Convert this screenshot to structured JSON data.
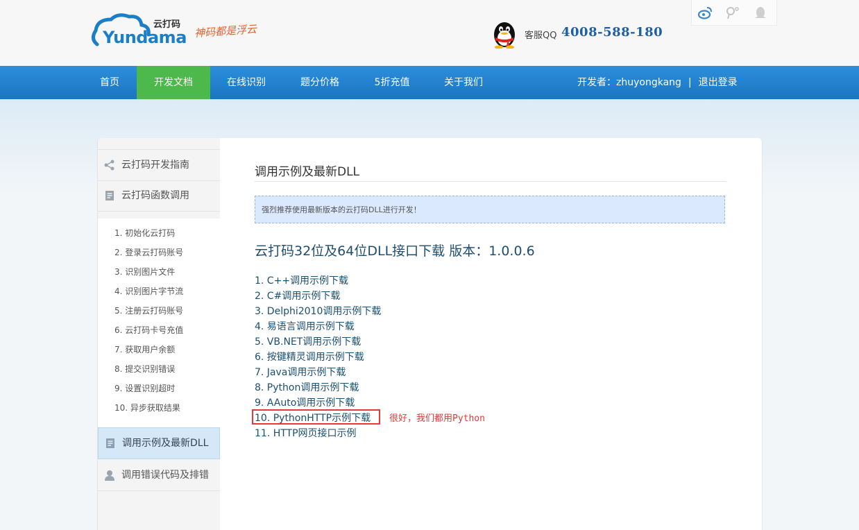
{
  "header": {
    "logo_cn": "云打码",
    "logo_en": "Yundama",
    "slogan": "神码都是浮云",
    "service_label": "客服QQ",
    "service_phone": "4008-588-180",
    "social_icons": [
      "weibo-icon",
      "tencent-weibo-icon",
      "qq-icon"
    ]
  },
  "nav": {
    "items": [
      {
        "label": "首页"
      },
      {
        "label": "开发文档",
        "active": true
      },
      {
        "label": "在线识别"
      },
      {
        "label": "题分价格"
      },
      {
        "label": "5折充值"
      },
      {
        "label": "关于我们"
      }
    ],
    "developer_label": "开发者：zhuyongkang",
    "separator": "|",
    "logout": "退出登录",
    "active_color": "#4db94c",
    "bar_color": "#1f7fce"
  },
  "sidebar": {
    "sections": [
      {
        "label": "云打码开发指南",
        "icon": "share-icon"
      },
      {
        "label": "云打码函数调用",
        "icon": "document-icon"
      }
    ],
    "sub_items": [
      "1. 初始化云打码",
      "2. 登录云打码账号",
      "3. 识别图片文件",
      "4. 识别图片字节流",
      "5. 注册云打码账号",
      "6. 云打码卡号充值",
      "7. 获取用户余额",
      "8. 提交识别错误",
      "9. 设置识别超时",
      "10. 异步获取结果"
    ],
    "active_section": {
      "label": "调用示例及最新DLL",
      "icon": "document-icon"
    },
    "last_section": {
      "label": "调用错误代码及排错",
      "icon": "user-icon"
    }
  },
  "content": {
    "title": "调用示例及最新DLL",
    "notice": "强烈推荐使用最新版本的云打码DLL进行开发！",
    "download_title": "云打码32位及64位DLL接口下载 版本：1.0.0.6",
    "links": [
      "1. C++调用示例下载",
      "2. C#调用示例下载",
      "3. Delphi2010调用示例下载",
      "4. 易语言调用示例下载",
      "5. VB.NET调用示例下载",
      "6. 按键精灵调用示例下载",
      "7. Java调用示例下载",
      "8. Python调用示例下载",
      "9. AAuto调用示例下载",
      "10. PythonHTTP示例下载",
      "11. HTTP网页接口示例"
    ],
    "annotation": "很好，我们都用Python",
    "annotation_color": "#e03a3a"
  }
}
